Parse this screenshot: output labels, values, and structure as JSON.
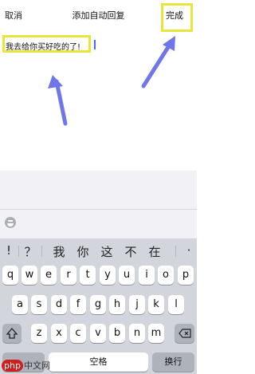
{
  "nav": {
    "cancel": "取消",
    "title": "添加自动回复",
    "done": "完成"
  },
  "message": {
    "text": "我去给你买好吃的了!"
  },
  "suggestions": [
    "!",
    "？",
    "我",
    "你",
    "这",
    "不",
    "在",
    "·"
  ],
  "keyboard": {
    "row1": [
      "q",
      "w",
      "e",
      "r",
      "t",
      "y",
      "u",
      "i",
      "o",
      "p"
    ],
    "row2": [
      "a",
      "s",
      "d",
      "f",
      "g",
      "h",
      "j",
      "k",
      "l"
    ],
    "row3": [
      "z",
      "x",
      "c",
      "v",
      "b",
      "n",
      "m"
    ],
    "space": "空格",
    "return": "换行"
  },
  "icons": {
    "shift": "shift-icon",
    "backspace": "backspace-icon",
    "emoji": "emoji-icon"
  },
  "colors": {
    "highlight": "#e9e53b",
    "arrow": "#6e76ea",
    "cursor": "#3f6fff"
  },
  "watermark": {
    "brand": "php",
    "suffix": "中文网"
  }
}
